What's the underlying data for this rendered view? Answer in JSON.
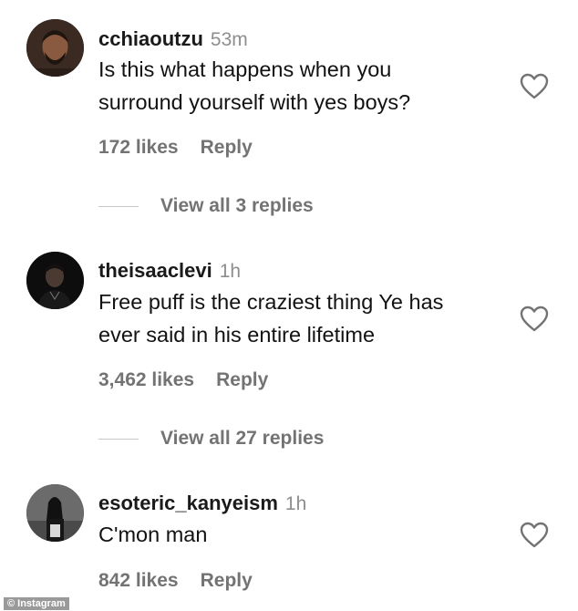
{
  "comments": [
    {
      "username": "cchiaoutzu",
      "time": "53m",
      "text_lines": [
        "Is this what happens when you",
        "surround yourself with yes boys?"
      ],
      "likes": "172 likes",
      "reply": "Reply",
      "view_replies": "View all 3 replies",
      "avatar_icon": "man-portrait-avatar"
    },
    {
      "username": "theisaaclevi",
      "time": "1h",
      "text_lines": [
        "Free puff is the craziest thing Ye has",
        "ever said in his entire lifetime"
      ],
      "likes": "3,462 likes",
      "reply": "Reply",
      "view_replies": "View all 27 replies",
      "avatar_icon": "dark-portrait-avatar"
    },
    {
      "username": "esoteric_kanyeism",
      "time": "1h",
      "text_lines": [
        "C'mon man"
      ],
      "likes": "842 likes",
      "reply": "Reply",
      "avatar_icon": "hooded-figure-avatar"
    }
  ],
  "watermark": "© Instagram",
  "colors": {
    "text": "#121212",
    "muted": "#737373",
    "timestamp": "#8e8e8e",
    "divider": "#c7c7c7"
  }
}
